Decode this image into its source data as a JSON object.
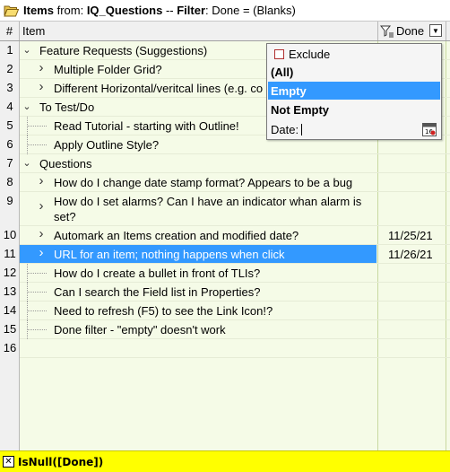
{
  "titlebar": {
    "label_items": "Items",
    "label_from": " from: ",
    "source": "IQ_Questions",
    "separator": " -- ",
    "label_filter": "Filter",
    "filter_text": ": Done = (Blanks)"
  },
  "columns": {
    "num": "#",
    "item": "Item",
    "done": "Done"
  },
  "rows": [
    {
      "n": "1",
      "text": "Feature Requests (Suggestions)",
      "chev": "open",
      "level": 0,
      "date": ""
    },
    {
      "n": "2",
      "text": "Multiple Folder Grid?",
      "chev": "closed",
      "level": 1,
      "date": ""
    },
    {
      "n": "3",
      "text": "Different  Horizontal/veritcal lines (e.g. co",
      "chev": "closed",
      "level": 1,
      "date": ""
    },
    {
      "n": "4",
      "text": "To Test/Do",
      "chev": "open",
      "level": 0,
      "date": ""
    },
    {
      "n": "5",
      "text": "Read Tutorial - starting with Outline!",
      "chev": "",
      "level": 1,
      "date": ""
    },
    {
      "n": "6",
      "text": "Apply Outline Style?",
      "chev": "",
      "level": 1,
      "date": ""
    },
    {
      "n": "7",
      "text": "Questions",
      "chev": "open",
      "level": 0,
      "date": ""
    },
    {
      "n": "8",
      "text": "How do I change date stamp format? Appears to be a bug",
      "chev": "closed",
      "level": 1,
      "date": ""
    },
    {
      "n": "9",
      "text": "How do I set alarms? Can I have an indicator whan alarm is",
      "text2": "set?",
      "chev": "closed",
      "level": 1,
      "date": ""
    },
    {
      "n": "10",
      "text": "Automark an Items creation and modified date?",
      "chev": "closed",
      "level": 1,
      "date": "11/25/21"
    },
    {
      "n": "11",
      "text": "URL for an item; nothing happens when click",
      "chev": "closed",
      "level": 1,
      "date": "11/26/21",
      "selected": true
    },
    {
      "n": "12",
      "text": "How do I create a bullet in front of TLIs?",
      "chev": "",
      "level": 1,
      "date": ""
    },
    {
      "n": "13",
      "text": "Can I search the Field list in Properties?",
      "chev": "",
      "level": 1,
      "date": ""
    },
    {
      "n": "14",
      "text": "Need to refresh (F5) to see the Link Icon!?",
      "chev": "",
      "level": 1,
      "date": ""
    },
    {
      "n": "15",
      "text": "Done filter - \"empty\" doesn't work",
      "chev": "",
      "level": 1,
      "date": ""
    },
    {
      "n": "16",
      "text": "",
      "chev": "",
      "level": 0,
      "date": ""
    }
  ],
  "filter_popup": {
    "exclude_label": "Exclude",
    "options": [
      "(All)",
      "Empty",
      "Not Empty"
    ],
    "selected_option": "Empty",
    "date_label": "Date:",
    "date_value": ""
  },
  "status": {
    "formula": "IsNull([Done])"
  },
  "colors": {
    "selection": "#3399ff",
    "grid_bg": "#f5fbe7",
    "status_bg": "#ffff00"
  },
  "icons": {
    "title": "open-folder-icon",
    "done_header": "filter-funnel-icon",
    "dropdown": "chevron-down-icon",
    "date_picker": "calendar-icon",
    "status": "close-icon"
  }
}
